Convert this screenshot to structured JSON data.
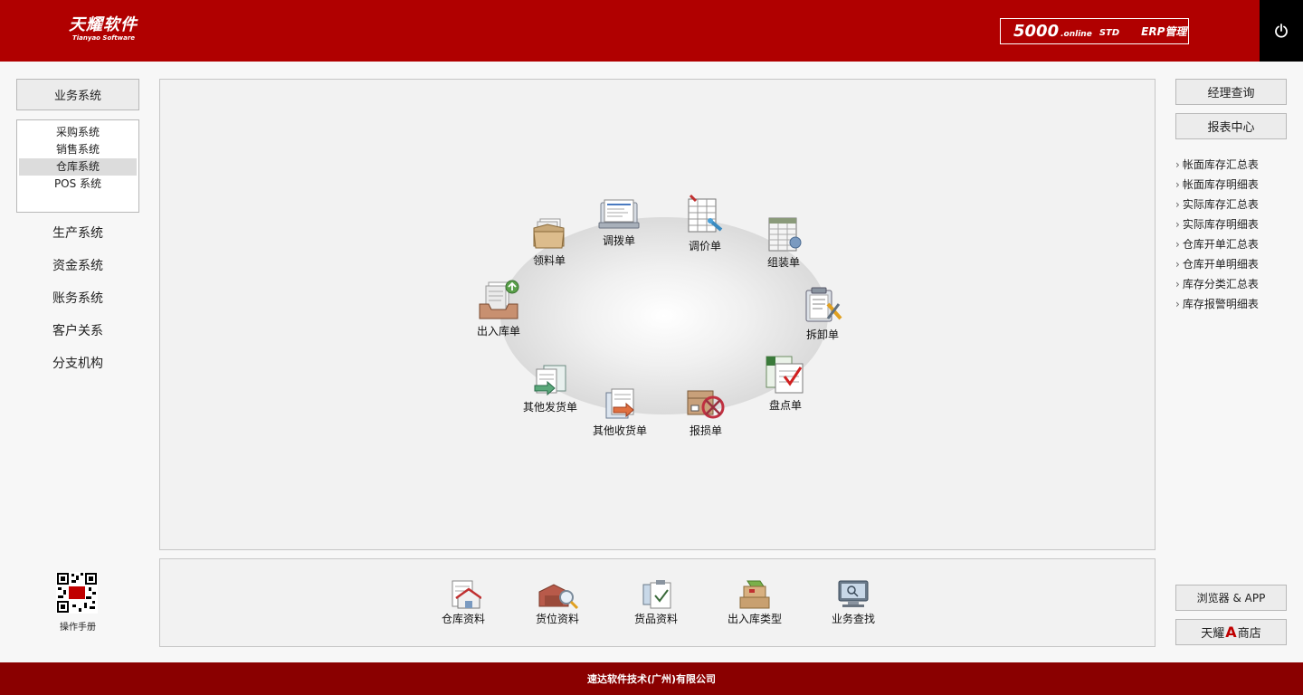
{
  "header": {
    "logo_cn": "天耀软件",
    "logo_en": "Tianyao Software",
    "edition_num": "5000",
    "edition_online": ".online",
    "edition_std": "STD",
    "edition_erp": "ERP管理"
  },
  "left_nav": {
    "business_system": "业务系统",
    "sub_items": [
      "采购系统",
      "销售系统",
      "仓库系统",
      "POS 系统"
    ],
    "active_sub": "仓库系统",
    "systems": [
      "生产系统",
      "资金系统",
      "账务系统",
      "客户关系",
      "分支机构"
    ],
    "manual_label": "操作手册"
  },
  "warehouse_flow": {
    "nodes": [
      "领料单",
      "调拨单",
      "调价单",
      "组装单",
      "出入库单",
      "拆卸单",
      "其他发货单",
      "盘点单",
      "其他收货单",
      "报损单"
    ]
  },
  "bottom_bar": {
    "items": [
      "仓库资料",
      "货位资料",
      "货品资料",
      "出入库类型",
      "业务查找"
    ]
  },
  "right_panel": {
    "manager_query": "经理查询",
    "report_center": "报表中心",
    "reports": [
      "帐面库存汇总表",
      "帐面库存明细表",
      "实际库存汇总表",
      "实际库存明细表",
      "仓库开单汇总表",
      "仓库开单明细表",
      "库存分类汇总表",
      "库存报警明细表"
    ],
    "browser_app": "浏览器 & APP",
    "store_prefix": "天耀",
    "store_letter": "A",
    "store_suffix": "商店"
  },
  "footer": {
    "company": "速达软件技术(广州)有限公司"
  },
  "colors": {
    "header_red": "#b00000",
    "footer_red": "#8a0000",
    "store_letter_red": "#c00000"
  }
}
